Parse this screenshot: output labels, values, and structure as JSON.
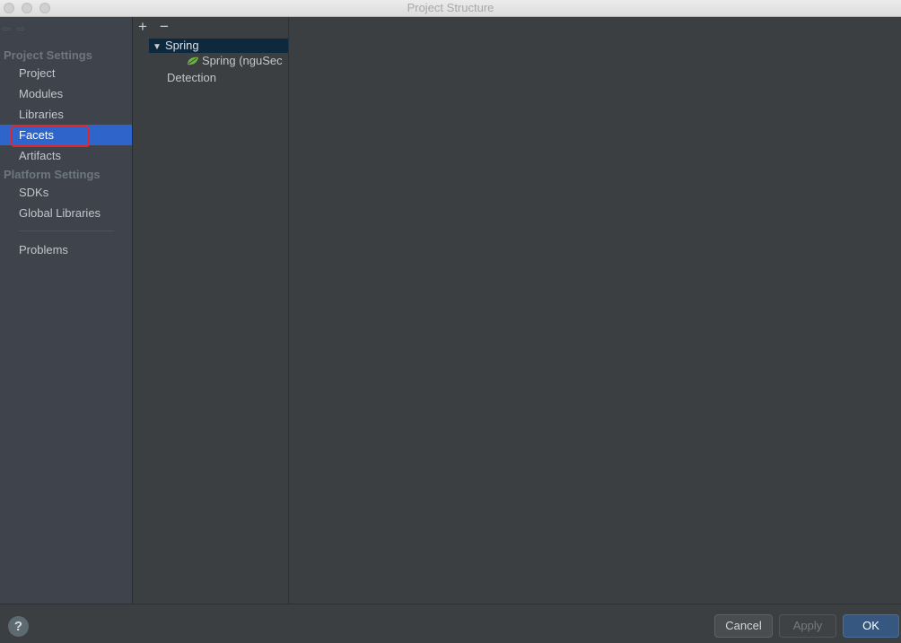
{
  "window": {
    "title": "Project Structure"
  },
  "sidebar": {
    "project_settings_header": "Project Settings",
    "project_items": [
      {
        "label": "Project"
      },
      {
        "label": "Modules"
      },
      {
        "label": "Libraries"
      },
      {
        "label": "Facets",
        "selected": true
      },
      {
        "label": "Artifacts"
      }
    ],
    "platform_settings_header": "Platform Settings",
    "platform_items": [
      {
        "label": "SDKs"
      },
      {
        "label": "Global Libraries"
      }
    ],
    "problems_label": "Problems"
  },
  "tree": {
    "add_icon": "+",
    "remove_icon": "−",
    "expander_icon": "▼",
    "nodes": [
      {
        "label": "Spring",
        "expanded": true,
        "selected": true
      },
      {
        "label": "Spring (nguSec",
        "icon": "spring-leaf-icon"
      },
      {
        "label": "Detection"
      }
    ]
  },
  "footer": {
    "help_icon": "?",
    "cancel_label": "Cancel",
    "apply_label": "Apply",
    "ok_label": "OK"
  },
  "colors": {
    "selection": "#2f65ca",
    "annotation_box": "#e0262d",
    "spring_green": "#6db33f",
    "ok_button": "#365880"
  }
}
